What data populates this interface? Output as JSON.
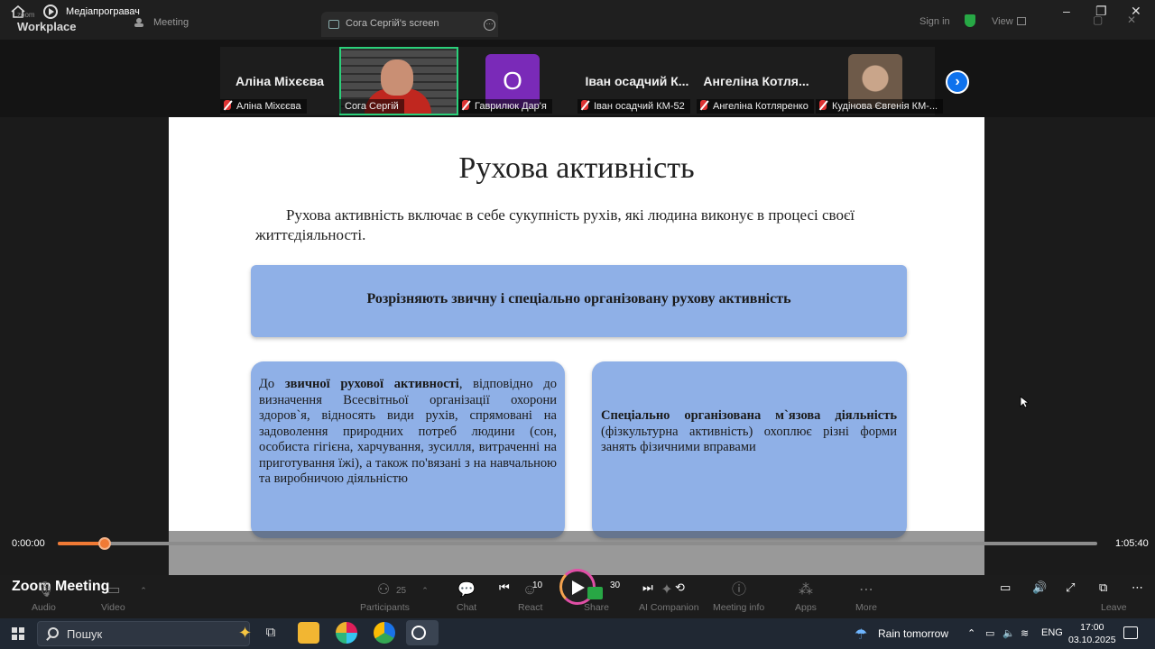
{
  "window": {
    "brand_small": "zoom",
    "brand": "Workplace",
    "player_title": "Медіапрогравач",
    "meeting_tab": "Meeting",
    "screen_tab": "Сога Сергій's screen",
    "sign_in": "Sign in",
    "view": "View"
  },
  "participants": [
    {
      "big_name": "Аліна Міхєєва",
      "label": "Аліна Міхєєва"
    },
    {
      "big_name": "",
      "label": "Сога Сергій",
      "active": true
    },
    {
      "big_name": "",
      "label": "Гаврилюк Дар'я",
      "avatar_letter": "O"
    },
    {
      "big_name": "Іван осадчий К...",
      "label": "Іван осадчий КМ-52"
    },
    {
      "big_name": "Ангеліна Котля...",
      "label": "Ангеліна Котляренко"
    },
    {
      "big_name": "",
      "label": "Кудінова Євгенія КМ-..."
    }
  ],
  "slide": {
    "title": "Рухова активність",
    "intro": "Рухова активність включає в себе сукупність рухів, які людина виконує в процесі своєї життєдіяльності.",
    "banner": "Розрізняють звичну і спеціально організовану рухову активність",
    "left_card": {
      "pre": "До ",
      "bold": "звичної рухової активності",
      "post": ", відповідно до визначення Всесвітньої організації охорони здоров`я, відносять види рухів, спрямовані на задоволення природних потреб людини (сон, особиста гігієна, харчування, зусилля, витраченні на приготування їжі), а також по'вязані з на навчальною та виробничою діяльністю"
    },
    "right_card": {
      "bold": "Спеціально організована м`язова діяльність",
      "post": " (фізкультурна активність) охоплює різні форми занять фізичними вправами"
    }
  },
  "player": {
    "time_current": "0:00:00",
    "time_total": "1:05:40",
    "progress": 0.045
  },
  "toolbar": {
    "title": "Zoom Meeting",
    "audio": "Audio",
    "video": "Video",
    "participants": "Participants",
    "participants_count": "25",
    "chat": "Chat",
    "react": "React",
    "share": "Share",
    "ai_companion": "AI Companion",
    "meeting_info": "Meeting info",
    "apps": "Apps",
    "more": "More",
    "leave": "Leave",
    "skip_back": "10",
    "skip_fwd": "30"
  },
  "taskbar": {
    "search": "Пошук",
    "weather": "Rain tomorrow",
    "lang": "ENG",
    "time": "17:00",
    "date": "03.10.2025"
  }
}
